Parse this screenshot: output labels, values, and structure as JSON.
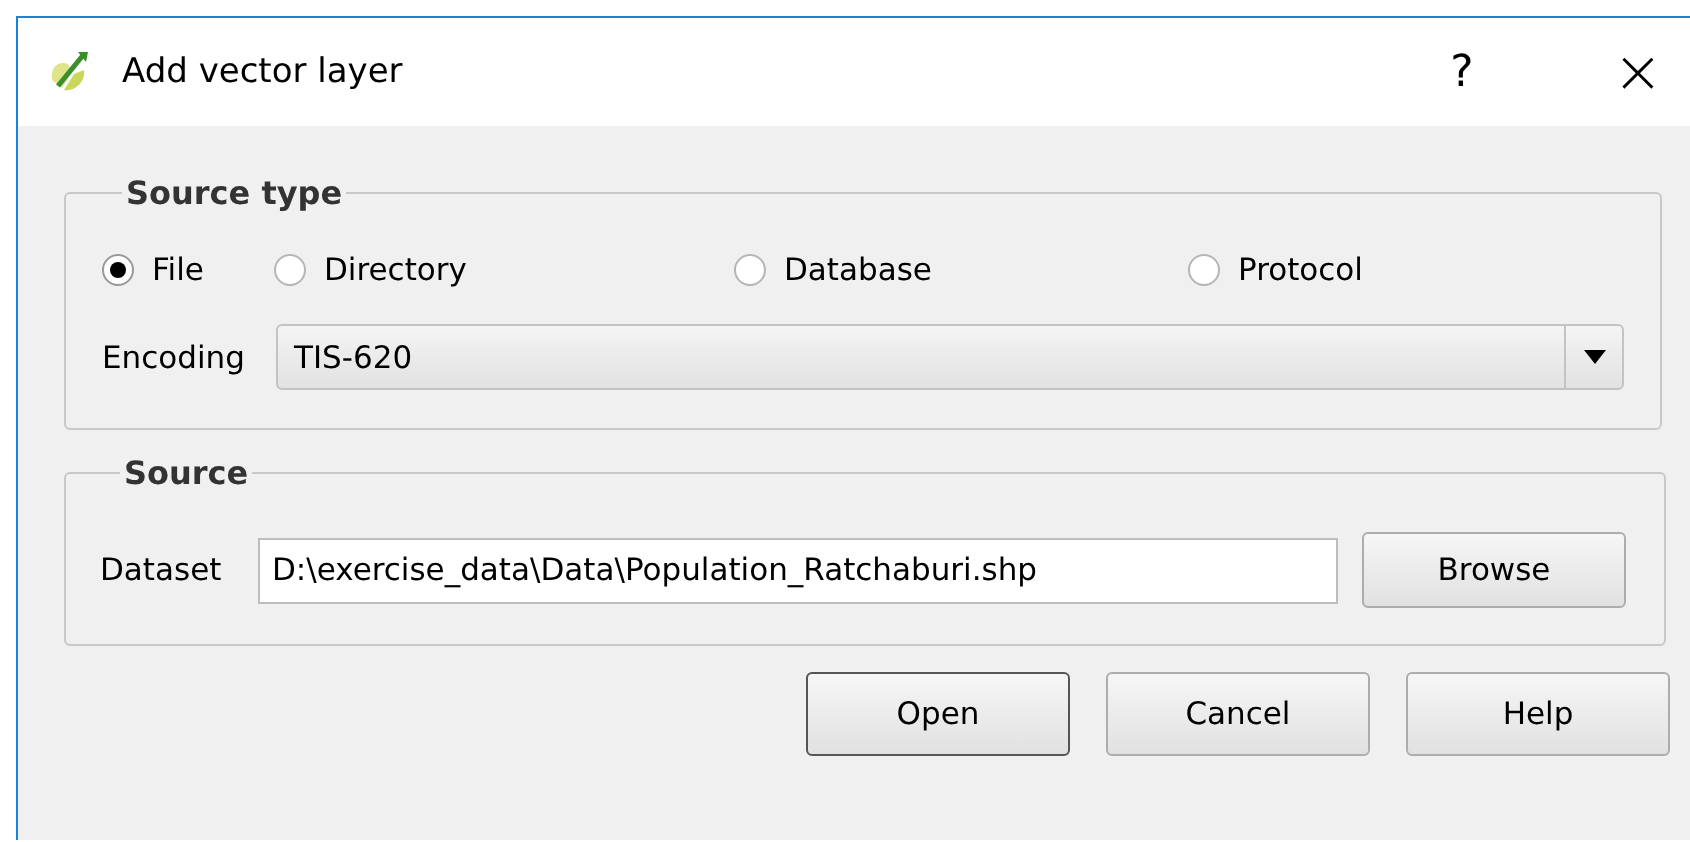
{
  "window": {
    "title": "Add vector layer",
    "help": "?",
    "close": "×"
  },
  "source_type": {
    "title": "Source type",
    "options": [
      {
        "label": "File",
        "selected": true
      },
      {
        "label": "Directory",
        "selected": false
      },
      {
        "label": "Database",
        "selected": false
      },
      {
        "label": "Protocol",
        "selected": false
      }
    ],
    "encoding_label": "Encoding",
    "encoding_value": "TIS-620"
  },
  "source": {
    "title": "Source",
    "dataset_label": "Dataset",
    "dataset_value": "D:\\exercise_data\\Data\\Population_Ratchaburi.shp",
    "browse": "Browse"
  },
  "buttons": [
    {
      "label": "Open",
      "default": true
    },
    {
      "label": "Cancel",
      "default": false
    },
    {
      "label": "Help",
      "default": false
    }
  ]
}
